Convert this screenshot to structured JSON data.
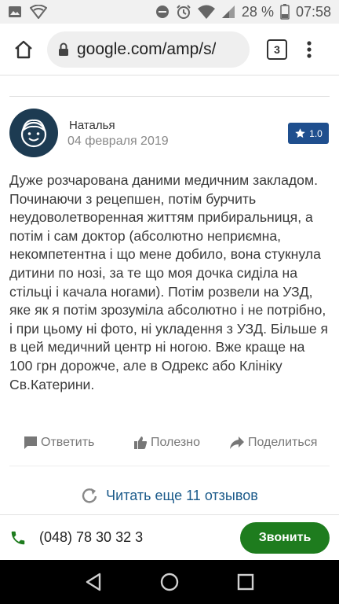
{
  "status_bar": {
    "battery_percent": "28 %",
    "time": "07:58",
    "left_icons": [
      "image-icon",
      "wifi-shield-icon"
    ],
    "right_icons": [
      "do-not-disturb-icon",
      "alarm-icon",
      "wifi-icon",
      "signal-icon",
      "battery-icon"
    ]
  },
  "browser": {
    "url": "google.com/amp/s/",
    "tab_count": "3"
  },
  "review": {
    "author": "Наталья",
    "date": "04 февраля 2019",
    "rating": "1.0",
    "text": "Дуже розчарована даними медичним закладом. Починаючи з рецепшен, потім бурчить неудоволетворенная життям прибиральниця, а потім і сам доктор (абсолютно неприємна, некомпетентна і що мене добило, вона стукнула дитини по нозі, за те що моя дочка сиділа на стільці і качала ногами). Потім розвели на УЗД, яке як я потім зрозуміла абсолютно і не потрібно, і при цьому ні фото, ні укладення з УЗД. Більше я в цей медичний центр ні ногою. Вже краще на 100 грн дорожче, але в Одрекс або Клініку Св.Катерини."
  },
  "actions": {
    "reply": "Ответить",
    "useful": "Полезно",
    "share": "Поделиться"
  },
  "more_reviews": "Читать еще 11 отзывов",
  "call_bar": {
    "phone": "(048) 78 30 32 3",
    "call_label": "Звонить"
  },
  "colors": {
    "accent_blue": "#1f4f8e",
    "link_blue": "#1b5a8a",
    "call_green": "#1e7c1e"
  }
}
